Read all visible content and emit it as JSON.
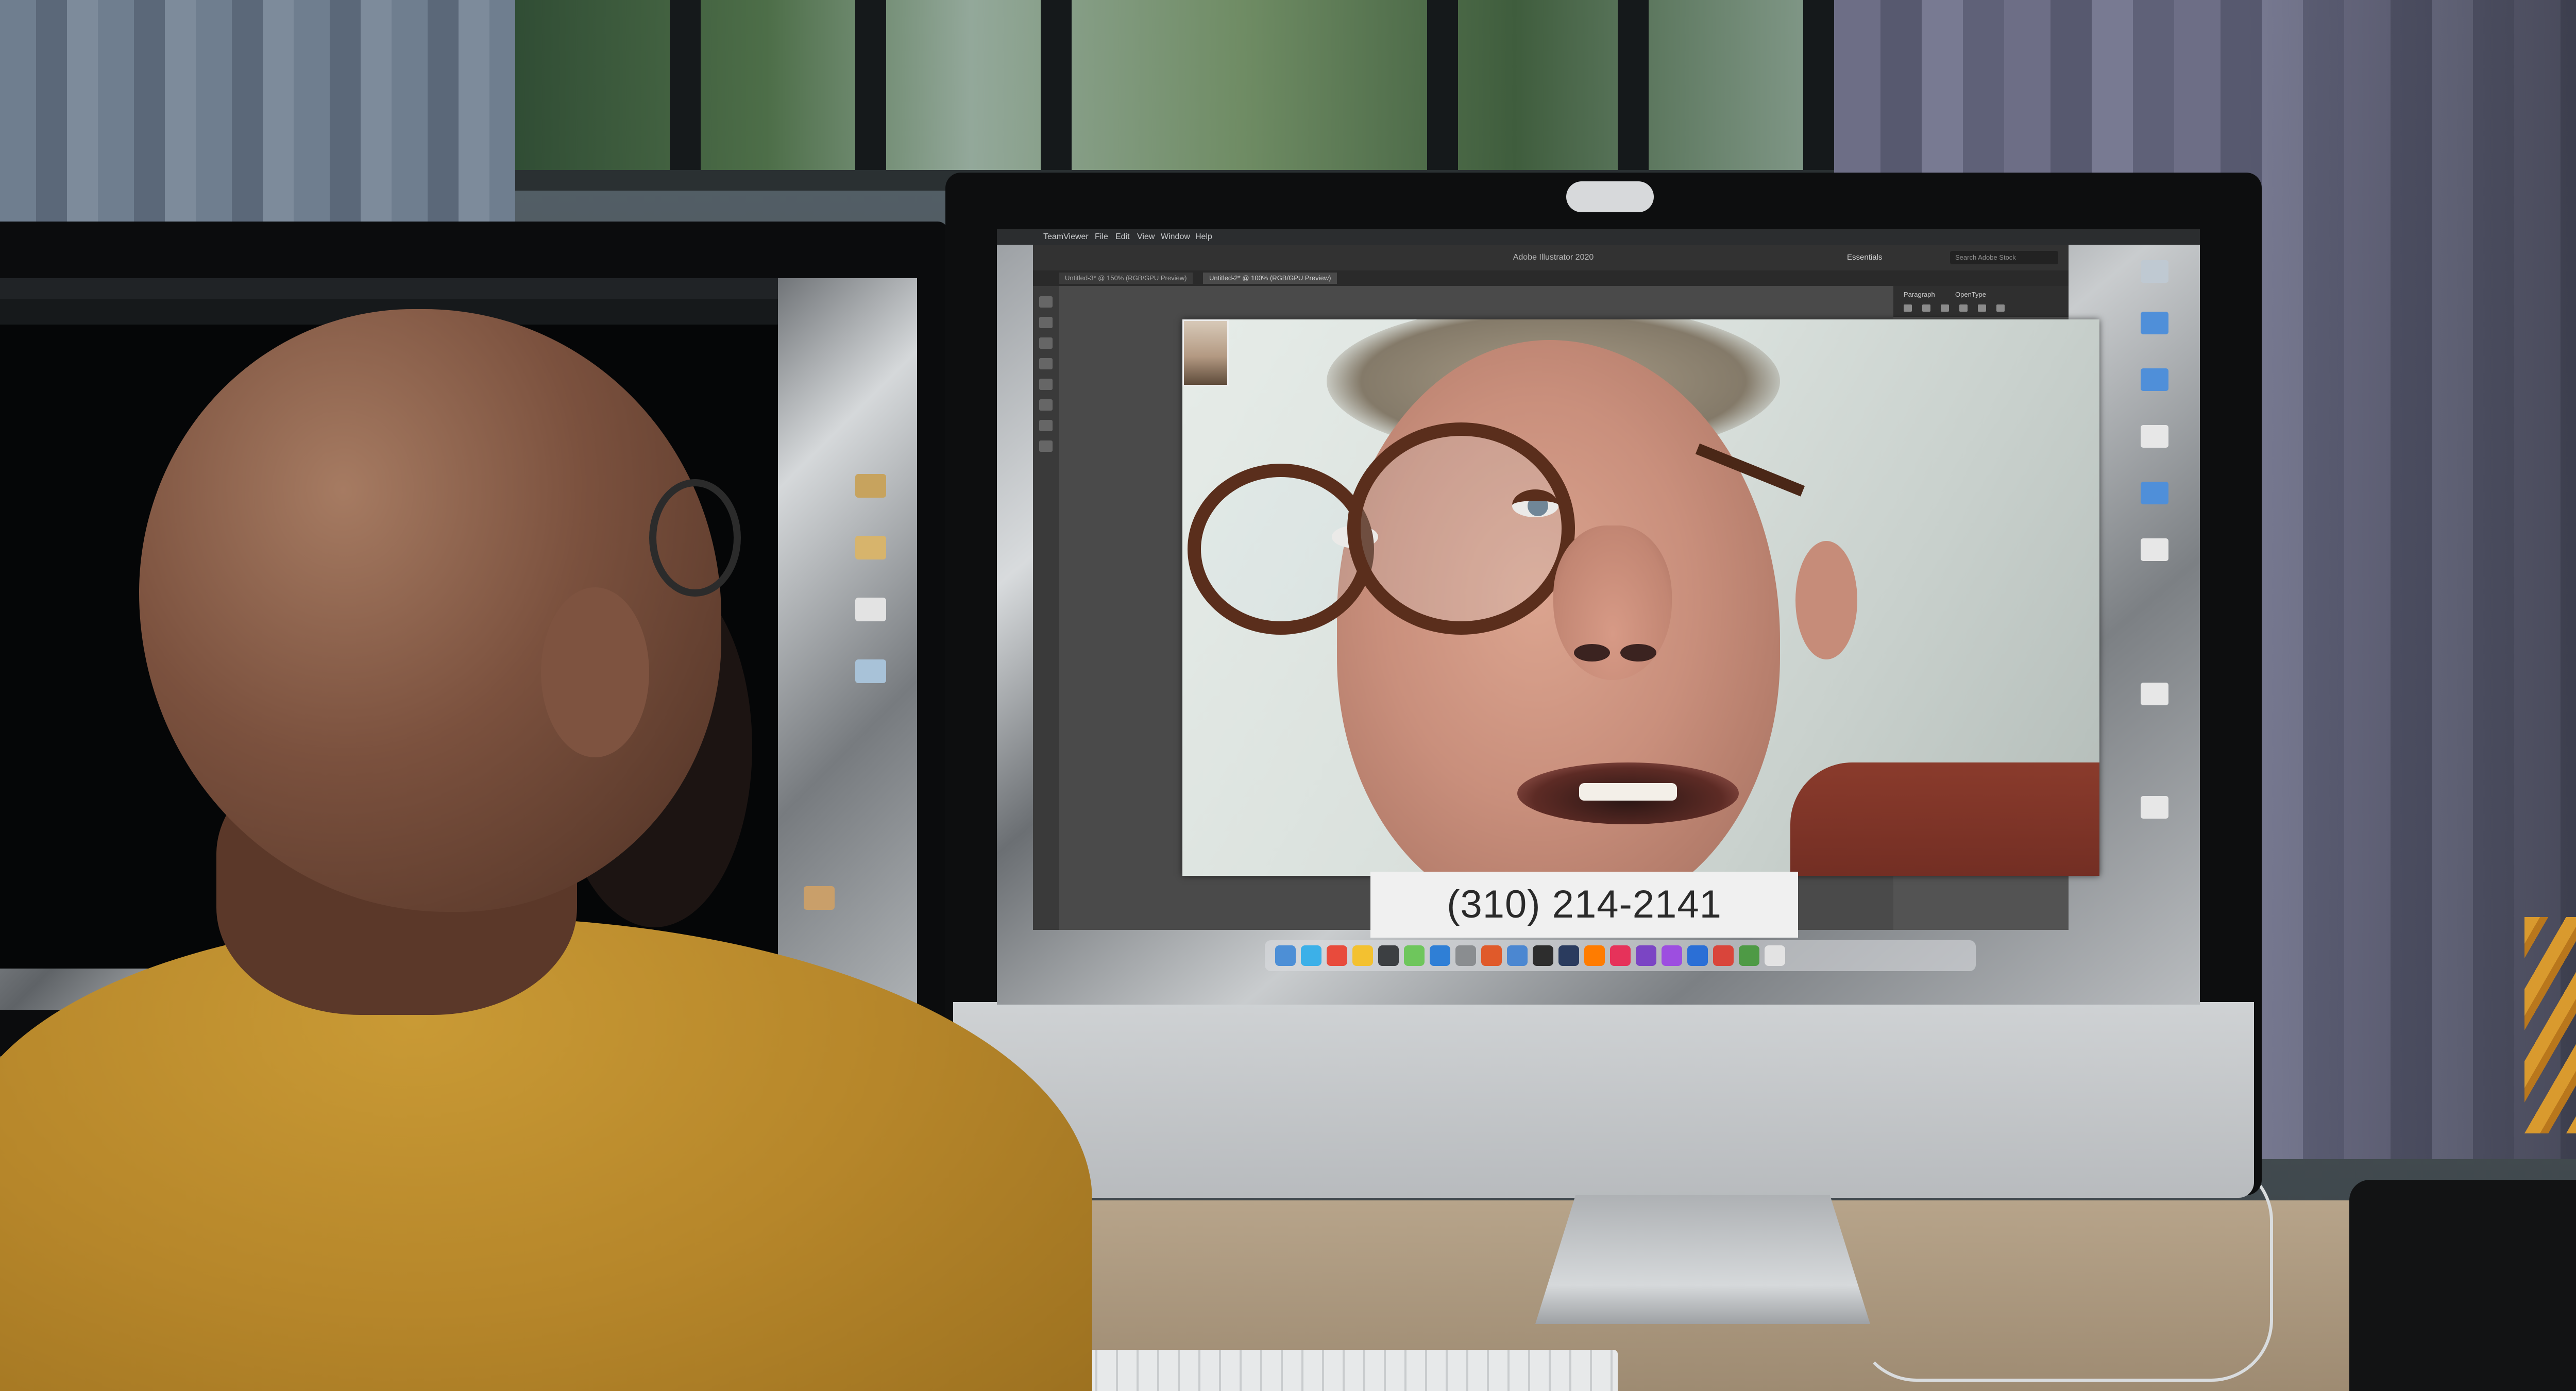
{
  "scene": "photo-of-workspace-with-video-call",
  "screen": {
    "menubar": {
      "app_name": "TeamViewer",
      "items": [
        "File",
        "Edit",
        "View",
        "Window",
        "Help"
      ]
    },
    "app": {
      "title": "Adobe Illustrator 2020",
      "tabs": [
        {
          "label": "Untitled-3* @ 150% (RGB/GPU Preview)",
          "active": false
        },
        {
          "label": "Untitled-2* @ 100% (RGB/GPU Preview)",
          "active": true
        }
      ],
      "workspace": "Essentials",
      "search_placeholder": "Search Adobe Stock",
      "panel_tabs": [
        "Paragraph",
        "OpenType"
      ]
    },
    "call": {
      "caption_text": "(310) 214-2141"
    }
  },
  "colors": {
    "caption_bg": "#f0f0f0",
    "ai_chrome": "#323232",
    "shirt": "#b6862a"
  }
}
